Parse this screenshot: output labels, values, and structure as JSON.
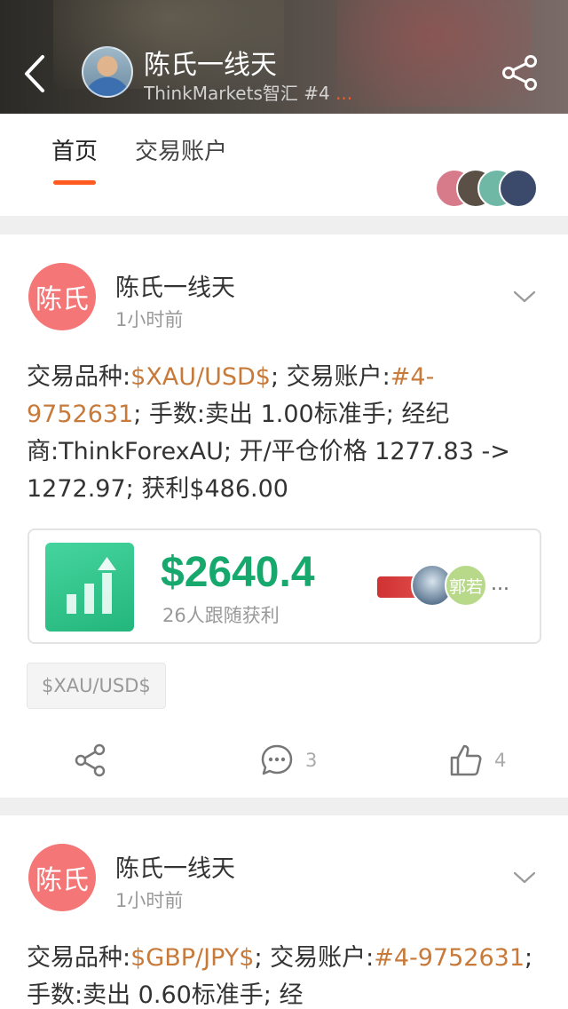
{
  "header": {
    "title": "陈氏一线天",
    "subtitle": "ThinkMarkets智汇 #4",
    "subtitle_more": "...",
    "back_icon": "chevron-left-icon",
    "share_icon": "share-icon"
  },
  "tabs": [
    {
      "label": "首页",
      "active": true
    },
    {
      "label": "交易账户",
      "active": false
    }
  ],
  "accent_color": "#ff5a1f",
  "posts": [
    {
      "avatar_text": "陈氏",
      "author": "陈氏一线天",
      "time": "1小时前",
      "text": {
        "p1": "交易品种:",
        "symbol": "$XAU/USD$",
        "p2": "; 交易账户:",
        "account": "#4-9752631",
        "p3": "; 手数:卖出 1.00标准手; 经纪商:ThinkForexAU; 开/平仓价格 1277.83 -> 1272.97; 获利$486.00"
      },
      "profit": {
        "amount": "$2640.4",
        "label": "26人跟随获利",
        "follower_3_text": "郭若",
        "more": "..."
      },
      "tag": "$XAU/USD$",
      "actions": {
        "comment_count": "3",
        "like_count": "4"
      }
    },
    {
      "avatar_text": "陈氏",
      "author": "陈氏一线天",
      "time": "1小时前",
      "text": {
        "p1": "交易品种:",
        "symbol": "$GBP/JPY$",
        "p2": "; 交易账户:",
        "account": "#4-9752631",
        "p3": "; 手数:卖出 0.60标准手; 经"
      }
    }
  ]
}
